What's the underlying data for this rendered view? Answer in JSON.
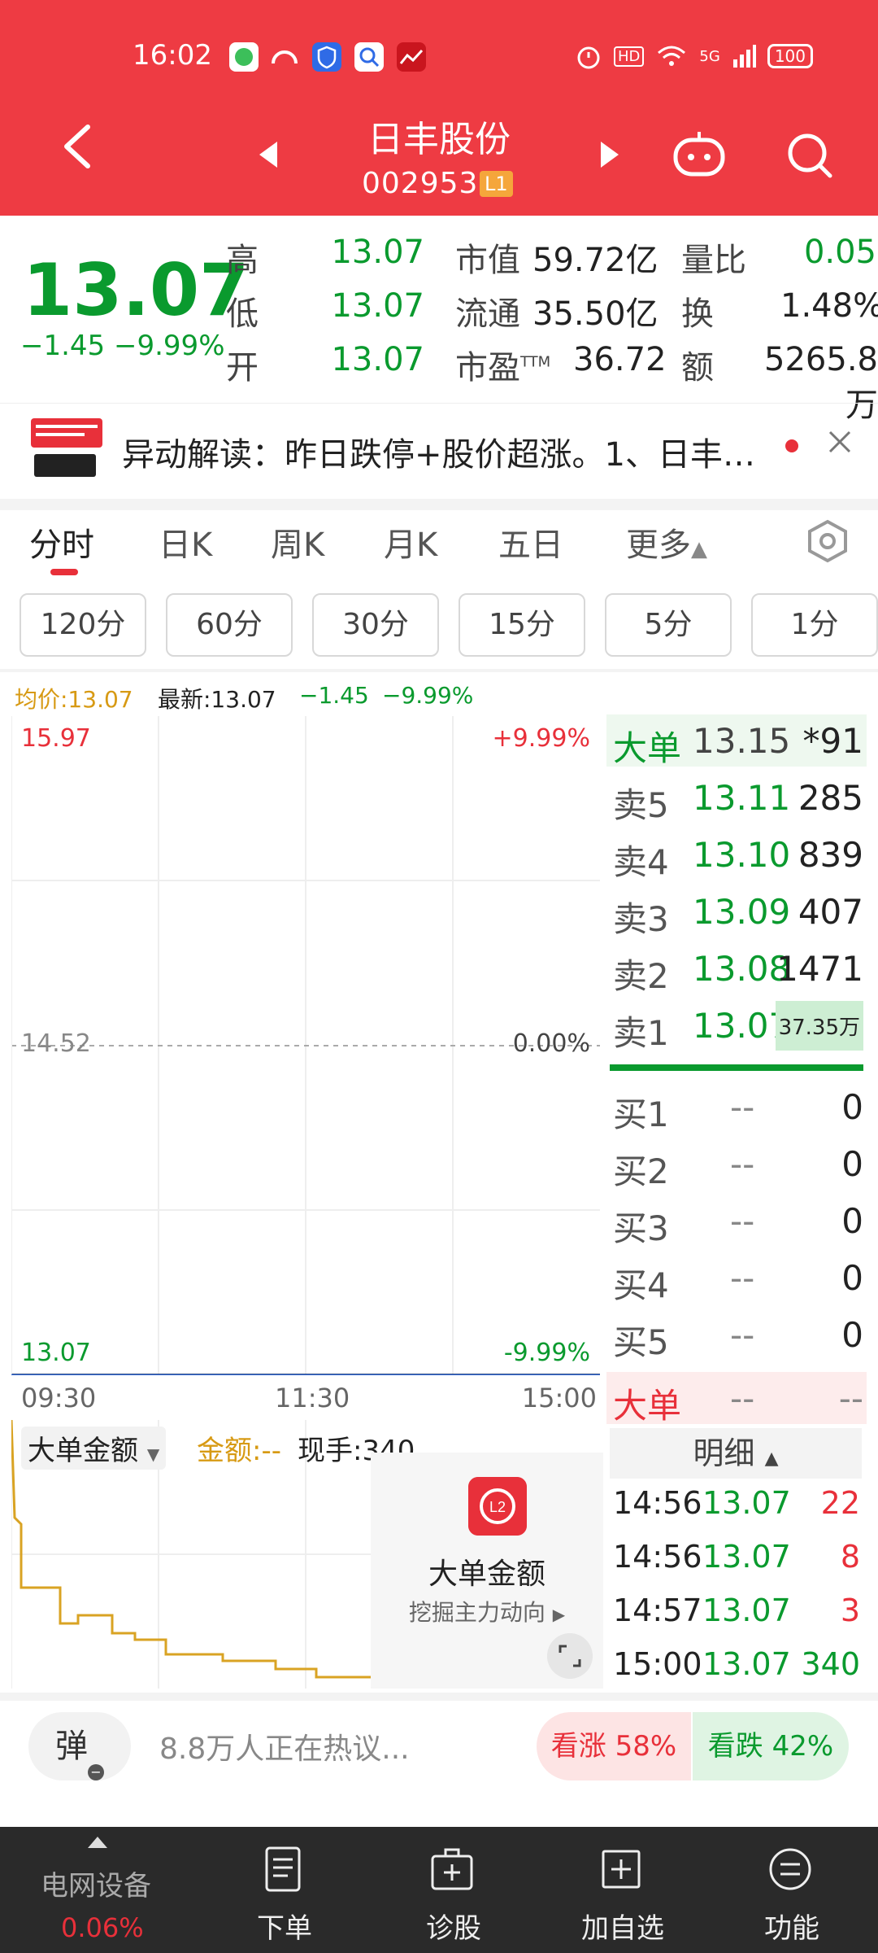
{
  "status_bar": {
    "time": "16:02",
    "network": "5G",
    "battery": "100"
  },
  "header": {
    "stock_name": "日丰股份",
    "stock_code": "002953",
    "level": "L1"
  },
  "quote": {
    "price": "13.07",
    "change": "−1.45",
    "change_pct": "−9.99%",
    "high_label": "高",
    "high": "13.07",
    "low_label": "低",
    "low": "13.07",
    "open_label": "开",
    "open": "13.07",
    "mcap_label": "市值",
    "mcap": "59.72亿",
    "float_label": "流通",
    "float": "35.50亿",
    "pe_label": "市盈",
    "pe_sup": "TTM",
    "pe": "36.72",
    "vr_label": "量比",
    "vr": "0.05",
    "turnover_label": "换",
    "turnover": "1.48%",
    "amount_label": "额",
    "amount": "5265.8万"
  },
  "anomaly": {
    "text": "异动解读：昨日跌停+股价超涨。1、日丰…"
  },
  "tabs": {
    "items": [
      "分时",
      "日K",
      "周K",
      "月K",
      "五日",
      "更多"
    ],
    "active": "分时"
  },
  "periods": [
    "120分",
    "60分",
    "30分",
    "15分",
    "5分",
    "1分"
  ],
  "chart_header": {
    "avg": "均价:13.07",
    "latest": "最新:13.07",
    "change": "−1.45",
    "pct": "−9.99%"
  },
  "chart_data": {
    "type": "line",
    "y_ticks_left": {
      "top": "15.97",
      "mid": "14.52",
      "bottom": "13.07"
    },
    "y_ticks_right": {
      "top": "+9.99%",
      "mid": "0.00%",
      "bottom": "-9.99%"
    },
    "x_ticks": [
      "09:30",
      "11:30",
      "15:00"
    ],
    "ylim": [
      13.07,
      15.97
    ],
    "price_line": [
      13.07,
      13.07
    ]
  },
  "order_book": {
    "big_label": "大单",
    "big_price": "13.15",
    "big_vol": "*91",
    "asks": [
      {
        "label": "卖5",
        "price": "13.11",
        "vol": "285"
      },
      {
        "label": "卖4",
        "price": "13.10",
        "vol": "839"
      },
      {
        "label": "卖3",
        "price": "13.09",
        "vol": "407"
      },
      {
        "label": "卖2",
        "price": "13.08",
        "vol": "1471"
      },
      {
        "label": "卖1",
        "price": "13.07",
        "vol": "37.35万"
      }
    ],
    "bids": [
      {
        "label": "买1",
        "price": "--",
        "vol": "0"
      },
      {
        "label": "买2",
        "price": "--",
        "vol": "0"
      },
      {
        "label": "买3",
        "price": "--",
        "vol": "0"
      },
      {
        "label": "买4",
        "price": "--",
        "vol": "0"
      },
      {
        "label": "买5",
        "price": "--",
        "vol": "0"
      }
    ],
    "big2_label": "大单",
    "big2_price": "--",
    "big2_vol": "--"
  },
  "indicator": {
    "select": "大单金额",
    "amount": "金额:--",
    "hand": "现手:340",
    "promo_title": "大单金额",
    "promo_sub": "挖掘主力动向"
  },
  "detail": {
    "header": "明细",
    "rows": [
      {
        "time": "14:56",
        "price": "13.07",
        "vol": "22",
        "color": "#e8303a"
      },
      {
        "time": "14:56",
        "price": "13.07",
        "vol": "8",
        "color": "#e8303a"
      },
      {
        "time": "14:57",
        "price": "13.07",
        "vol": "3",
        "color": "#e8303a"
      },
      {
        "time": "15:00",
        "price": "13.07",
        "vol": "340",
        "color": "#0a9a2e"
      }
    ]
  },
  "discuss": {
    "danmu": "弹",
    "text": "8.8万人正在热议...",
    "bull": "看涨 58%",
    "bear": "看跌 42%"
  },
  "bottom_nav": {
    "sector_name": "电网设备",
    "sector_pct": "0.06%",
    "items": [
      "下单",
      "诊股",
      "加自选",
      "功能"
    ]
  }
}
